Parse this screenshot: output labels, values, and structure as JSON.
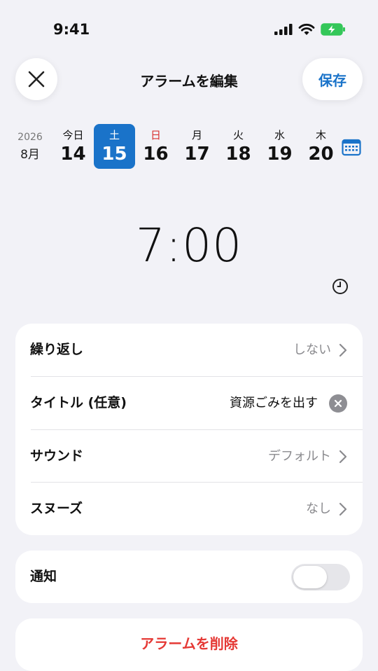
{
  "status": {
    "time": "9:41"
  },
  "header": {
    "title": "アラームを編集",
    "save_label": "保存"
  },
  "calendar": {
    "year": "2026",
    "month": "8月",
    "days": [
      {
        "dow": "今日",
        "num": "14"
      },
      {
        "dow": "土",
        "num": "15",
        "selected": true
      },
      {
        "dow": "日",
        "num": "16"
      },
      {
        "dow": "月",
        "num": "17"
      },
      {
        "dow": "火",
        "num": "18"
      },
      {
        "dow": "水",
        "num": "19"
      },
      {
        "dow": "木",
        "num": "20"
      }
    ]
  },
  "alarm": {
    "time": "7:00"
  },
  "settings": {
    "repeat": {
      "label": "繰り返し",
      "value": "しない"
    },
    "title": {
      "label": "タイトル (任意)",
      "value": "資源ごみを出す"
    },
    "sound": {
      "label": "サウンド",
      "value": "デフォルト"
    },
    "snooze": {
      "label": "スヌーズ",
      "value": "なし"
    }
  },
  "notify": {
    "label": "通知",
    "enabled": false
  },
  "delete_label": "アラームを削除",
  "colors": {
    "accent": "#1a73c9",
    "danger": "#e53935",
    "battery": "#34c759"
  }
}
